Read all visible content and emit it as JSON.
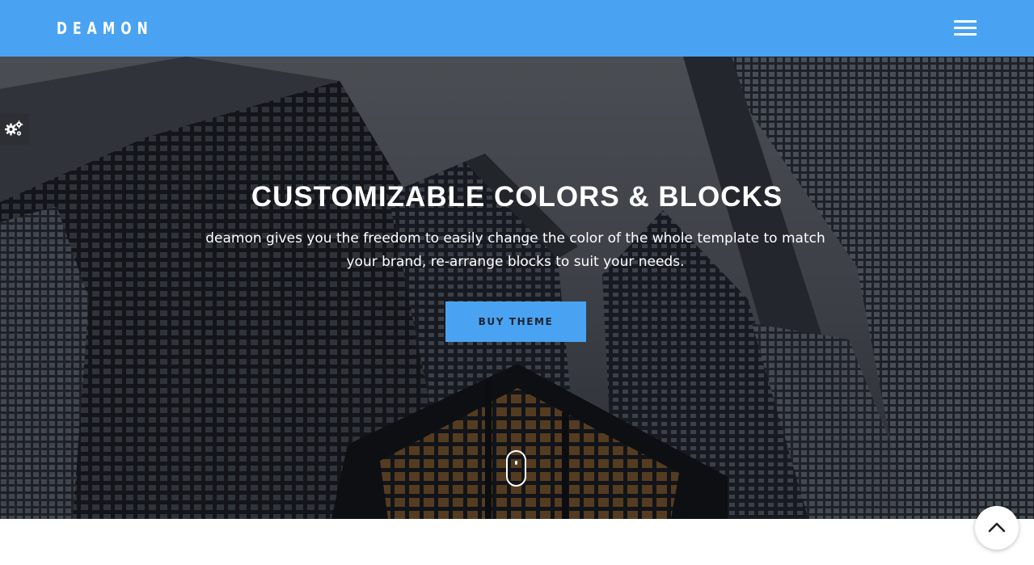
{
  "header": {
    "logo": "DEAMON",
    "background": "#4aa3f2"
  },
  "hero": {
    "title": "CUSTOMIZABLE COLORS & BLOCKS",
    "description_line1": "deamon gives you the freedom to easily change the color of the whole template to match",
    "description_line2": "your brand, re-arrange blocks to suit your needs.",
    "button_label": "BUY THEME",
    "button_color": "#4aa3f2"
  },
  "icons": {
    "menu": "hamburger-icon",
    "settings": "gears-icon",
    "scroll": "scroll-mouse-icon",
    "back_to_top": "chevron-up-icon"
  }
}
